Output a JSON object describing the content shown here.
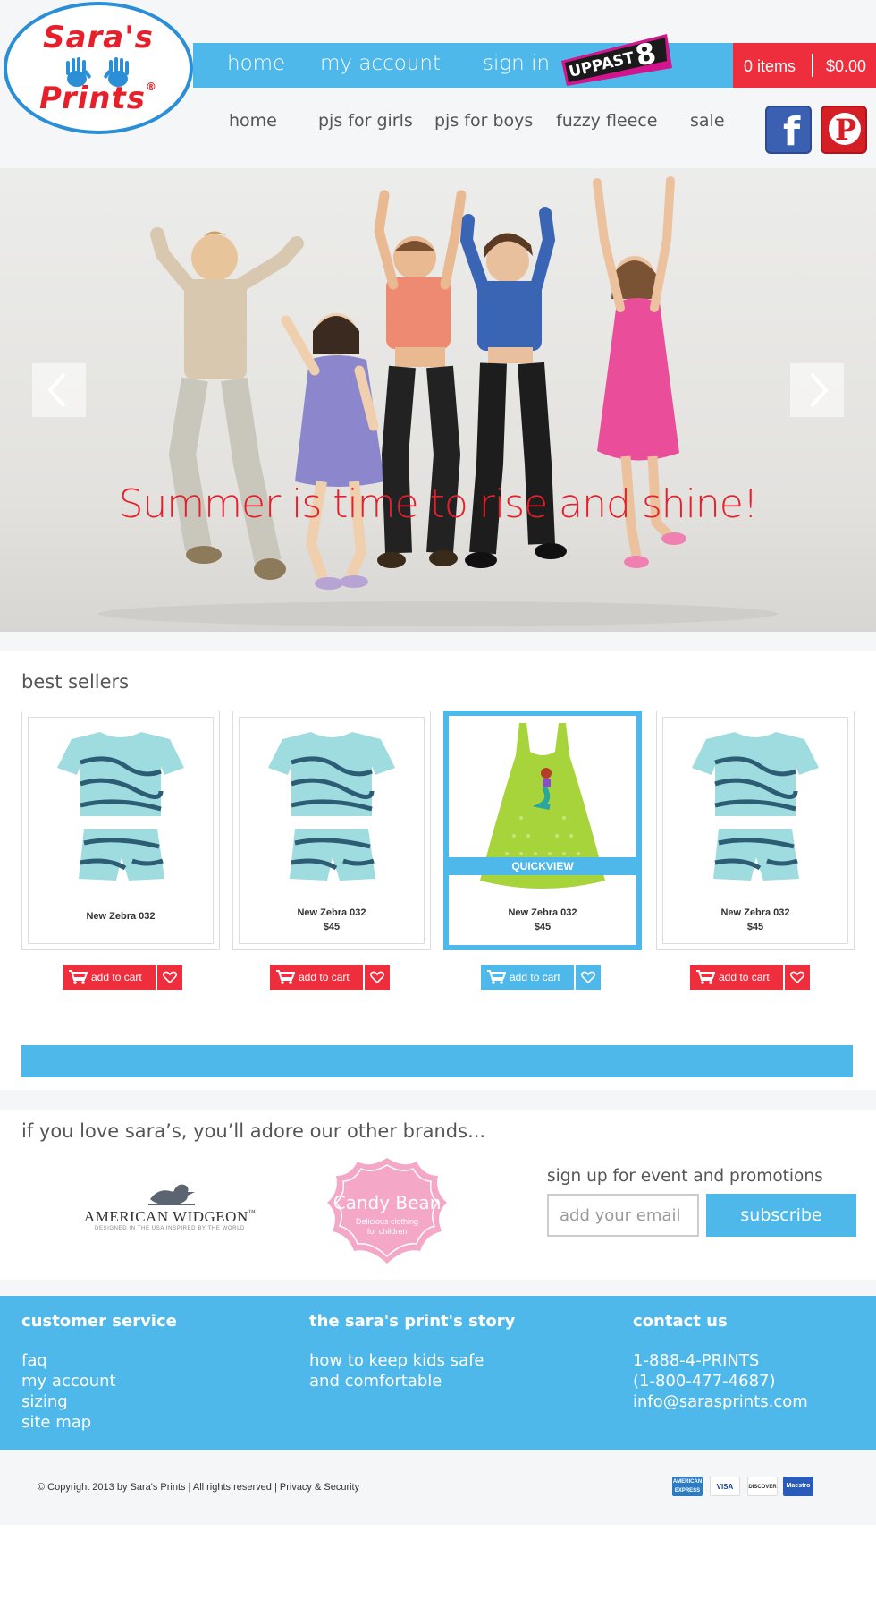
{
  "brand": {
    "logo_line1": "Sara's",
    "logo_line2": "Prints",
    "registered": "®"
  },
  "top_nav": {
    "items": [
      "home",
      "my account",
      "sign in"
    ],
    "badge_text": "UP PAST 8"
  },
  "cart": {
    "items_label": "0 items",
    "total": "$0.00"
  },
  "sub_nav": {
    "items": [
      "home",
      "pjs for girls",
      "pjs for boys",
      "fuzzy fleece",
      "sale"
    ]
  },
  "social": {
    "facebook_glyph": "f",
    "pinterest_glyph": "P"
  },
  "hero": {
    "caption": "Summer is time to rise and shine!"
  },
  "best_sellers": {
    "title": "best sellers",
    "quickview_label": "QUICKVIEW",
    "add_to_cart_label": "add to cart",
    "products": [
      {
        "name": "New Zebra 032",
        "price": "",
        "image": "pajama-set",
        "active": false
      },
      {
        "name": "New Zebra 032",
        "price": "$45",
        "image": "pajama-set",
        "active": false
      },
      {
        "name": "New Zebra 032",
        "price": "$45",
        "image": "green-dress",
        "active": true
      },
      {
        "name": "New Zebra 032",
        "price": "$45",
        "image": "pajama-set",
        "active": false
      }
    ]
  },
  "brands": {
    "title": "if you love sara’s, you’ll adore our other brands...",
    "american_widgeon": "AMERICAN WIDGEON",
    "american_widgeon_tm": "™",
    "american_widgeon_sub": "DESIGNED IN THE USA INSPIRED BY THE WORLD",
    "candy_bean": "Candy Bean",
    "candy_bean_sub": "Delicious clothing for children"
  },
  "signup": {
    "title": "sign up for event and promotions",
    "placeholder": "add your email",
    "button": "subscribe"
  },
  "footer": {
    "customer_service": {
      "heading": "customer service",
      "links": [
        "faq",
        "my account",
        "sizing",
        "site map"
      ]
    },
    "story": {
      "heading": "the sara's print's story",
      "links": [
        "how to keep kids safe",
        "and comfortable"
      ]
    },
    "contact": {
      "heading": "contact us",
      "lines": [
        "1-888-4-PRINTS",
        "(1-800-477-4687)",
        "info@sarasprints.com"
      ]
    }
  },
  "legal": {
    "copyright": "© Copyright 2013 by Sara's Prints  |  All rights reserved |  Privacy & Security"
  },
  "payments": [
    "AMERICAN EXPRESS",
    "VISA",
    "DISCOVER",
    "Maestro"
  ],
  "colors": {
    "brand_blue": "#4fb8ea",
    "brand_red": "#ee2d3d",
    "caption_red": "#e61f2b",
    "band_gray": "#f5f6f7"
  }
}
